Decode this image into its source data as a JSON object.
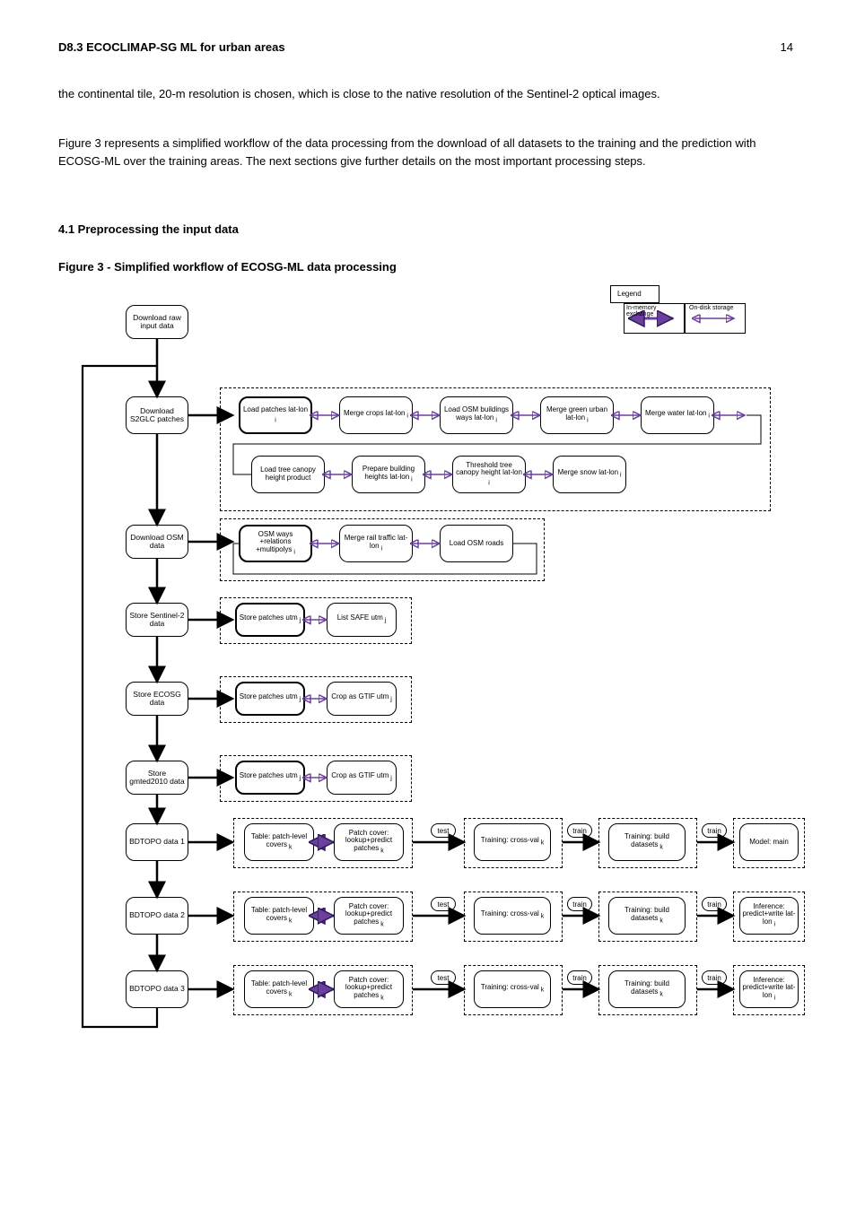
{
  "header": {
    "title": "D8.3 ECOCLIMAP-SG ML for urban areas",
    "page": "14"
  },
  "intro": {
    "p1": "the continental tile, 20-m resolution is chosen, which is close to the native resolution of the Sentinel-2 optical images.",
    "p2": "Figure 3 represents a simplified workflow of the data processing from the download of all datasets to the training and the prediction with ECOSG-ML over the training areas. The next sections give further details on the most important processing steps."
  },
  "sub": "4.1 Preprocessing the input data",
  "figcap": "Figure 3 - Simplified workflow of ECOSG-ML data processing",
  "legend": {
    "title": "Legend",
    "a": "In-memory exchange",
    "b": "On-disk storage"
  },
  "steps": {
    "s0": "Download raw input data",
    "s1": "Download S2GLC patches",
    "s2": "Download OSM data",
    "s3": "Store Sentinel-2 data",
    "s4": "Store ECOSG data",
    "s5": "Store gmted2010 data",
    "s6": "BDTOPO data 1",
    "s7": "BDTOPO data 2",
    "s8": "BDTOPO data 3"
  },
  "r1": {
    "a": "Load patches lat-lon",
    "b": "Merge crops lat-lon",
    "c": "Load OSM buildings ways lat-lon",
    "d": "Merge green urban lat-lon",
    "e": "Merge water lat-lon",
    "f": "Load tree canopy height product",
    "g": "Prepare building heights lat-lon",
    "h": "Threshold tree canopy height lat-lon",
    "i": "Merge snow lat-lon"
  },
  "r2": {
    "a": "OSM ways +relations +multipolys",
    "b": "Merge rail traffic lat-lon",
    "c": "Load OSM roads"
  },
  "r3": {
    "a": "Store patches utm",
    "b": "List SAFE utm"
  },
  "r4": {
    "a": "Store patches utm",
    "b": "Crop as GTIF utm"
  },
  "r5": {
    "a": "Store patches utm",
    "b": "Crop as GTIF utm"
  },
  "r6": {
    "a1": "Table: patch-level covers",
    "a2": "Patch cover: lookup+predict patches",
    "t1": "test",
    "b": "Training: cross-val",
    "t2": "train",
    "c": "Training: build datasets",
    "t3": "train",
    "d": "Model: main"
  },
  "r7": {
    "a1": "Table: patch-level covers",
    "a2": "Patch cover: lookup+predict patches",
    "t1": "test",
    "b": "Training: cross-val",
    "t2": "train",
    "c": "Training: build datasets",
    "t3": "train",
    "d": "Inference: predict+write lat-lon"
  },
  "r8": {
    "a1": "Table: patch-level covers",
    "a2": "Patch cover: lookup+predict patches",
    "t1": "test",
    "b": "Training: cross-val",
    "t2": "train",
    "c": "Training: build datasets",
    "t3": "train",
    "d": "Inference: predict+write lat-lon"
  }
}
